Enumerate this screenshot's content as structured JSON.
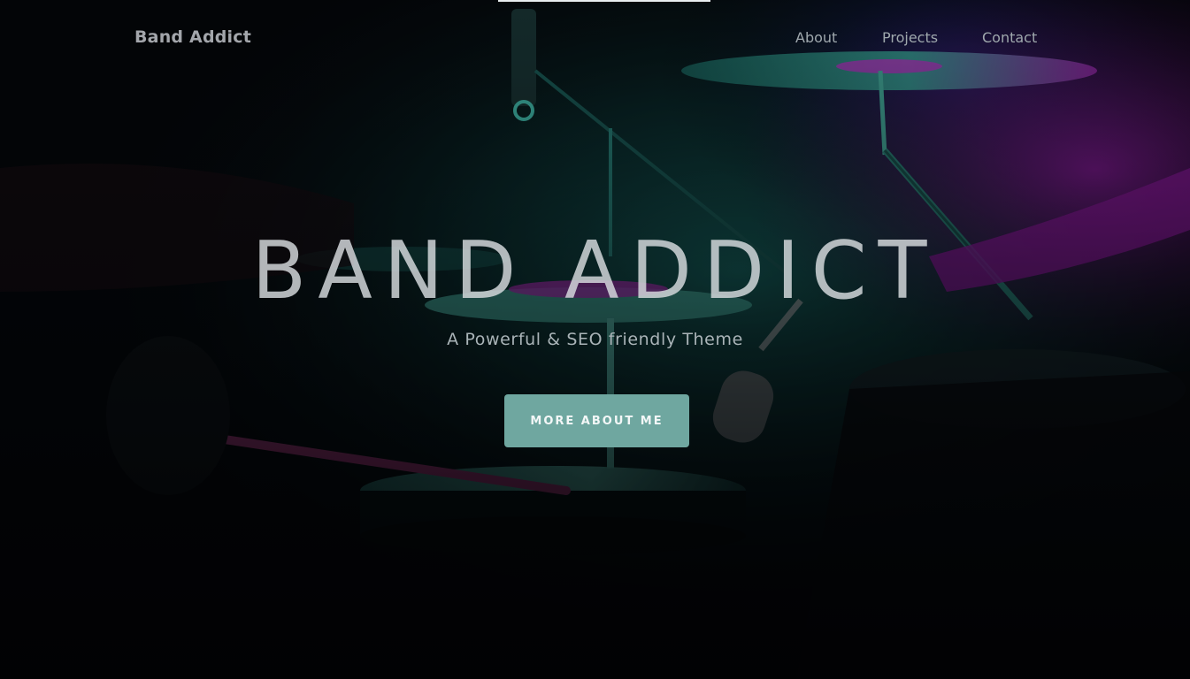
{
  "brand": {
    "name": "Band Addict"
  },
  "nav": {
    "items": [
      {
        "label": "About"
      },
      {
        "label": "Projects"
      },
      {
        "label": "Contact"
      }
    ]
  },
  "hero": {
    "title": "BAND ADDICT",
    "subtitle": "A Powerful & SEO friendly Theme",
    "cta_label": "MORE ABOUT ME",
    "background_image": "drummer-on-stage-teal-magenta-lighting"
  },
  "colors": {
    "button": "#6fa7a0",
    "teal_light": "#2fb3a3",
    "magenta_light": "#c21bd0",
    "background": "#05070b"
  }
}
